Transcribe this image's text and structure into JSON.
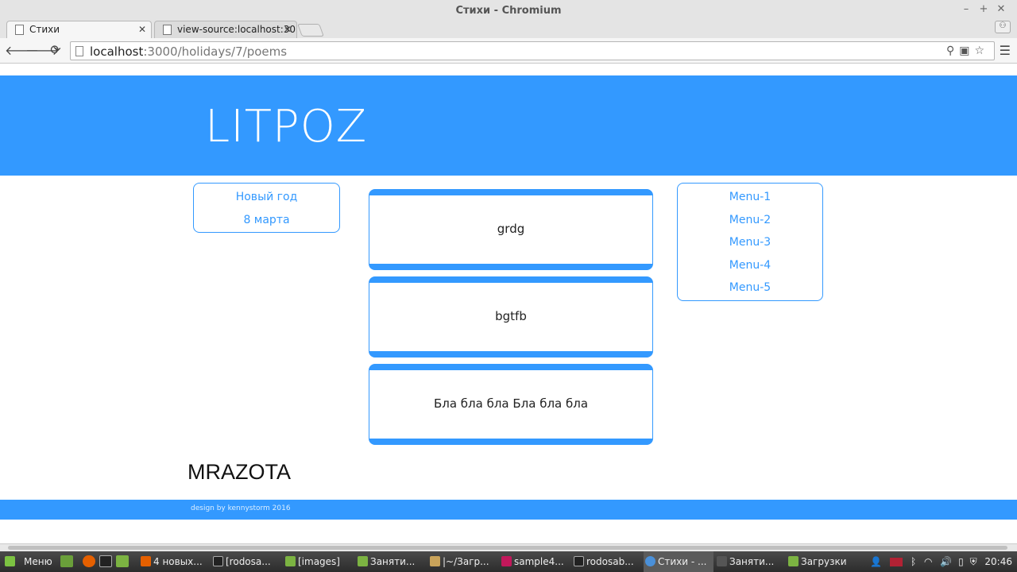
{
  "window": {
    "title": "Стихи - Chromium"
  },
  "tabs": [
    {
      "label": "Стихи"
    },
    {
      "label": "view-source:localhost:30"
    }
  ],
  "address": {
    "host": "localhost",
    "rest": ":3000/holidays/7/poems"
  },
  "site": {
    "logo": "LITPOZ",
    "left_nav": [
      {
        "label": "Новый год"
      },
      {
        "label": "8 марта"
      }
    ],
    "poems": [
      {
        "title": "grdg"
      },
      {
        "title": "bgtfb"
      },
      {
        "title": "Бла бла бла Бла бла бла"
      }
    ],
    "right_nav": [
      {
        "label": "Menu-1"
      },
      {
        "label": "Menu-2"
      },
      {
        "label": "Menu-3"
      },
      {
        "label": "Menu-4"
      },
      {
        "label": "Menu-5"
      }
    ],
    "brand": "MRAZOTA",
    "footer": "design by kennystorm 2016",
    "accent_color": "#3399ff"
  },
  "taskbar": {
    "menu_label": "Меню",
    "items": [
      {
        "label": "4 новых..."
      },
      {
        "label": "[rodosa..."
      },
      {
        "label": "[images]"
      },
      {
        "label": "Заняти..."
      },
      {
        "label": "|~/Загр..."
      },
      {
        "label": "sample4..."
      },
      {
        "label": "rodosab..."
      },
      {
        "label": "Стихи - ..."
      },
      {
        "label": "Заняти..."
      },
      {
        "label": "Загрузки"
      }
    ],
    "clock": "20:46"
  }
}
